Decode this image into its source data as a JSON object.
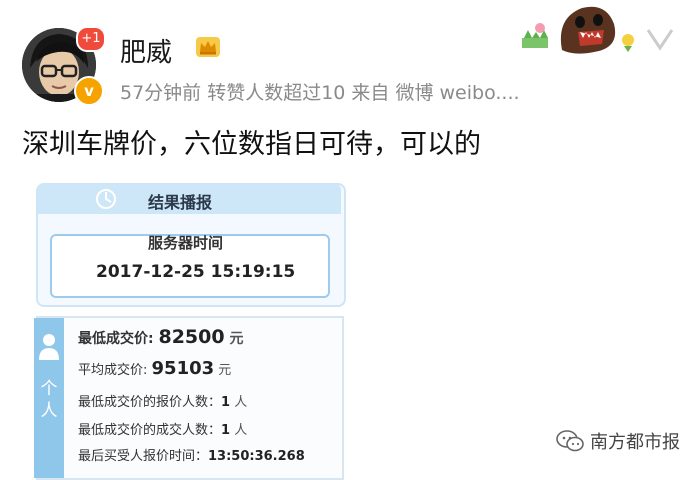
{
  "header": {
    "username": "肥威",
    "notification_badge": "+1",
    "verified_badge": "v",
    "meta": "57分钟前  转赞人数超过10   来自 微博 weibo...."
  },
  "post": {
    "text": "深圳车牌价，六位数指日可待，可以的"
  },
  "image": {
    "card_title": "结果播报",
    "server_time_label": "服务器时间",
    "server_time": "2017-12-25 15:19:15",
    "side_label": "个人",
    "rows": [
      {
        "label": "最低成交价: ",
        "value": "82500",
        "unit": " 元"
      },
      {
        "label": "平均成交价: ",
        "value": "95103",
        "unit": " 元"
      },
      {
        "label": "最低成交价的报价人数：",
        "value": "1",
        "unit": " 人"
      },
      {
        "label": "最低成交价的成交人数：",
        "value": "1",
        "unit": " 人"
      },
      {
        "label": "最后买受人报价时间：",
        "value": "13:50:36.268",
        "unit": ""
      }
    ]
  },
  "watermark": {
    "text": "南方都市报"
  },
  "colors": {
    "badge_red": "#f04a3a",
    "verified_orange": "#f6a300",
    "card_blue": "#cde6f8",
    "side_blue": "#8fc7ea"
  },
  "icons": [
    "crown-icon",
    "verified-icon",
    "refresh-icon",
    "person-icon",
    "wechat-icon",
    "sticker-icon"
  ]
}
